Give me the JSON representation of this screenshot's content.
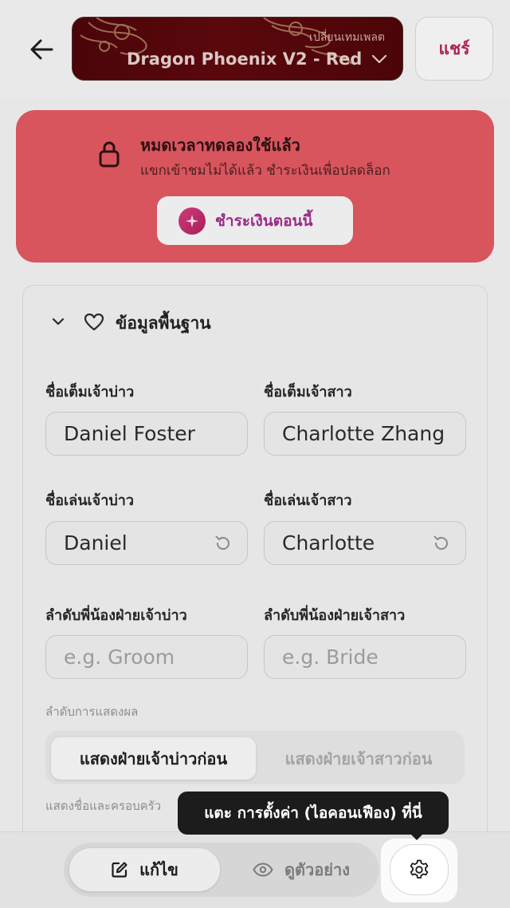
{
  "header": {
    "back_icon": "arrow-left-icon",
    "template_caption": "เปลี่ยนเทมเพลต",
    "template_name": "Dragon Phoenix V2 - Red",
    "share_label": "แชร์"
  },
  "trial_banner": {
    "title": "หมดเวลาทดลองใช้แล้ว",
    "subtitle": "แขกเข้าชมไม่ได้แล้ว ชำระเงินเพื่อปลดล็อก",
    "pay_label": "ชำระเงินตอนนี้",
    "color": "#d8555d"
  },
  "section": {
    "title": "ข้อมูลพื้นฐาน"
  },
  "fields": {
    "groom_full_label": "ชื่อเต็มเจ้าบ่าว",
    "groom_full_value": "Daniel Foster",
    "bride_full_label": "ชื่อเต็มเจ้าสาว",
    "bride_full_value": "Charlotte Zhang",
    "groom_nick_label": "ชื่อเล่นเจ้าบ่าว",
    "groom_nick_value": "Daniel",
    "bride_nick_label": "ชื่อเล่นเจ้าสาว",
    "bride_nick_value": "Charlotte",
    "groom_order_label": "ลำดับพี่น้องฝ่ายเจ้าบ่าว",
    "groom_order_placeholder": "e.g. Groom",
    "bride_order_label": "ลำดับพี่น้องฝ่ายเจ้าสาว",
    "bride_order_placeholder": "e.g. Bride"
  },
  "display_order": {
    "label": "ลำดับการแสดงผล",
    "option_groom_first": "แสดงฝ่ายเจ้าบ่าวก่อน",
    "option_bride_first": "แสดงฝ่ายเจ้าสาวก่อน",
    "selected": "แสดงฝ่ายเจ้าบ่าวก่อน",
    "hint": "แสดงชื่อและครอบครัว"
  },
  "tooltip": {
    "text": "แตะ การตั้งค่า (ไอคอนเฟือง) ที่นี่"
  },
  "bottom_bar": {
    "edit_label": "แก้ไข",
    "preview_label": "ดูตัวอย่าง",
    "active_mode": "แก้ไข",
    "settings_icon": "gear-icon"
  }
}
